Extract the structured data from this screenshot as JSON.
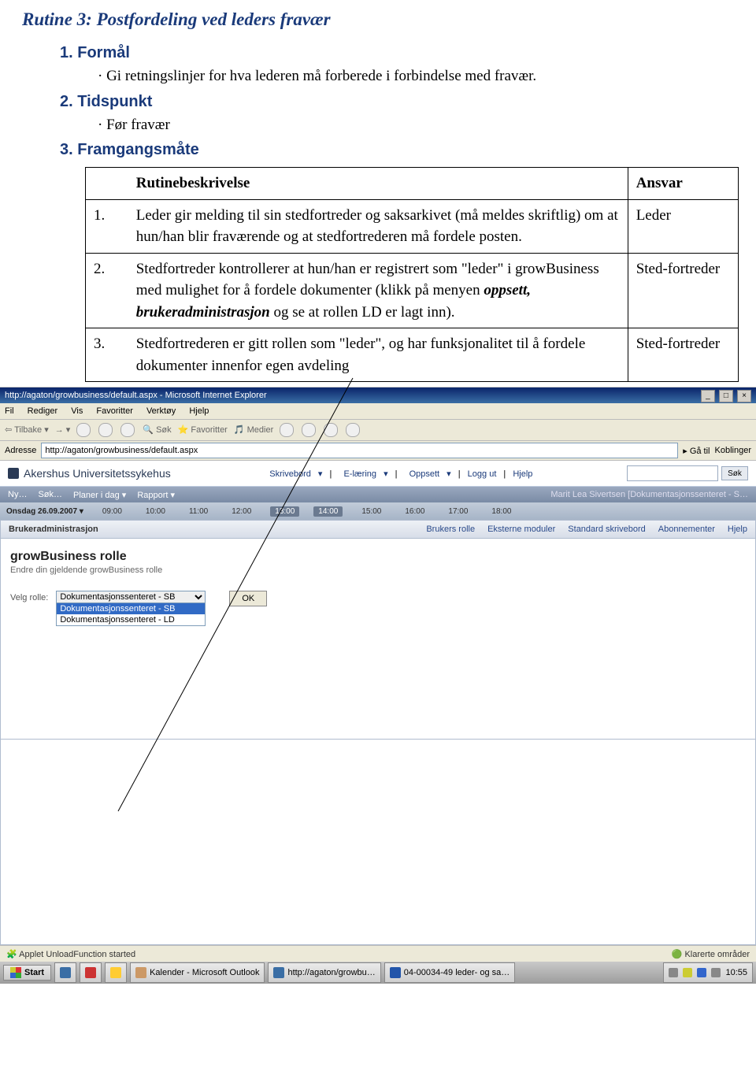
{
  "doc": {
    "title": "Rutine 3: Postfordeling ved leders fravær",
    "s1": {
      "num": "1.",
      "heading": "Formål",
      "bullet": "Gi retningslinjer for hva lederen må forberede i forbindelse med fravær."
    },
    "s2": {
      "num": "2.",
      "heading": "Tidspunkt",
      "bullet": "Før fravær"
    },
    "s3": {
      "num": "3.",
      "heading": "Framgangsmåte"
    },
    "table": {
      "header_desc": "Rutinebeskrivelse",
      "header_resp": "Ansvar",
      "rows": [
        {
          "n": "1.",
          "desc_pre": "Leder gir melding til sin stedfortreder og saksarkivet (må meldes skriftlig) om at hun/han blir fraværende og at stedfortrederen må fordele posten.",
          "resp": "Leder"
        },
        {
          "n": "2.",
          "desc_pre": "Stedfortreder kontrollerer at hun/han er registrert som \"leder\" i growBusiness med mulighet for å fordele dokumenter (klikk på menyen ",
          "desc_em": "oppsett, brukeradministrasjon",
          "desc_post": " og se at rollen LD er lagt inn).",
          "resp": "Sted-fortreder"
        },
        {
          "n": "3.",
          "desc_pre": "Stedfortrederen er gitt rollen som \"leder\", og har funksjonalitet til å fordele dokumenter innenfor egen avdeling",
          "resp": "Sted-fortreder"
        }
      ]
    }
  },
  "ie": {
    "title": "http://agaton/growbusiness/default.aspx - Microsoft Internet Explorer",
    "menu": [
      "Fil",
      "Rediger",
      "Vis",
      "Favoritter",
      "Verktøy",
      "Hjelp"
    ],
    "toolbar": {
      "back": "Tilbake",
      "search": "Søk",
      "favorites": "Favoritter",
      "media": "Medier"
    },
    "address_label": "Adresse",
    "address_value": "http://agaton/growbusiness/default.aspx",
    "go": "Gå til",
    "links": "Koblinger"
  },
  "app": {
    "brand": "Akershus Universitetssykehus",
    "menu": [
      "Skrivebord",
      "E-læring",
      "Oppsett",
      "Logg ut",
      "Hjelp"
    ],
    "search_btn": "Søk",
    "subbar": {
      "ny": "Ny…",
      "sok": "Søk…",
      "planer": "Planer i dag",
      "rapport": "Rapport",
      "right": "Marit Lea Sivertsen [Dokumentasjonssenteret - S…"
    },
    "timeline": {
      "date": "Onsdag 26.09.2007",
      "slots": [
        "09:00",
        "10:00",
        "11:00",
        "12:00",
        "13:00",
        "14:00",
        "15:00",
        "16:00",
        "17:00",
        "18:00"
      ]
    }
  },
  "panel": {
    "title": "Brukeradministrasjon",
    "tabs": [
      "Brukers rolle",
      "Eksterne moduler",
      "Standard skrivebord",
      "Abonnementer",
      "Hjelp"
    ],
    "gb_title": "growBusiness rolle",
    "gb_sub": "Endre din gjeldende growBusiness rolle",
    "role_label": "Velg rolle:",
    "selected": "Dokumentasjonssenteret - SB",
    "options": [
      "Dokumentasjonssenteret - SB",
      "Dokumentasjonssenteret - LD"
    ],
    "ok": "OK"
  },
  "status": {
    "left": "Applet UnloadFunction started",
    "right": "Klarerte områder"
  },
  "taskbar": {
    "start": "Start",
    "items": [
      "Kalender - Microsoft Outlook",
      "http://agaton/growbu…",
      "04-00034-49 leder- og sa…"
    ],
    "clock": "10:55"
  }
}
